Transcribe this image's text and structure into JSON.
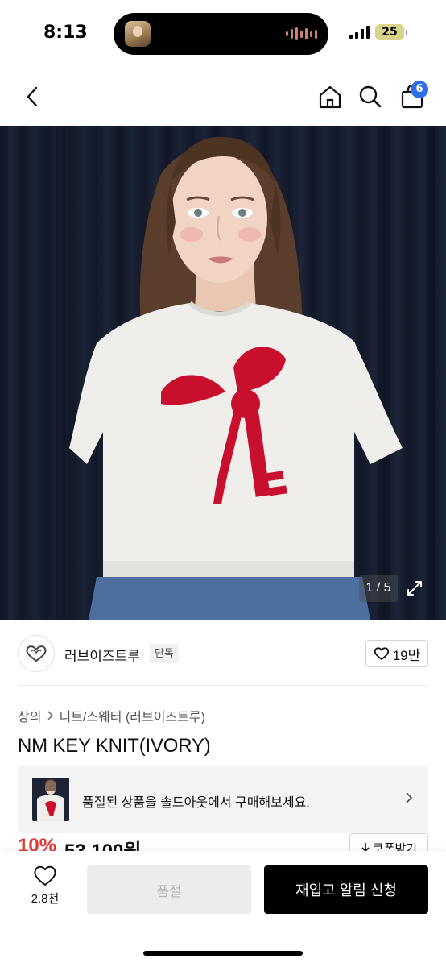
{
  "status_bar": {
    "time": "8:13",
    "battery": "25"
  },
  "nav": {
    "back_icon": "chevron-left-icon",
    "home_icon": "home-icon",
    "search_icon": "search-icon",
    "cart_icon": "shopping-bag-icon",
    "cart_count": "6"
  },
  "hero": {
    "counter": "1 / 5",
    "expand_icon": "expand-icon"
  },
  "brand": {
    "name": "러브이즈트루",
    "tag": "단독",
    "likes": "19만"
  },
  "breadcrumb": {
    "items": [
      "상의",
      "니트/스웨터 (러브이즈트루)"
    ]
  },
  "product": {
    "title": "NM KEY KNIT(IVORY)",
    "discount": "10%",
    "price": "53,100원",
    "coupon_label": "쿠폰받기"
  },
  "soldout_banner": {
    "text": "품절된 상품을 솔드아웃에서 구매해보세요."
  },
  "bottom_bar": {
    "wish_count": "2.8천",
    "soldout_label": "품절",
    "restock_label": "재입고 알림 신청"
  },
  "colors": {
    "accent_blue": "#2f6fe8",
    "discount_red": "#e53935",
    "primary_black": "#000000",
    "knit_red": "#c8102e"
  }
}
